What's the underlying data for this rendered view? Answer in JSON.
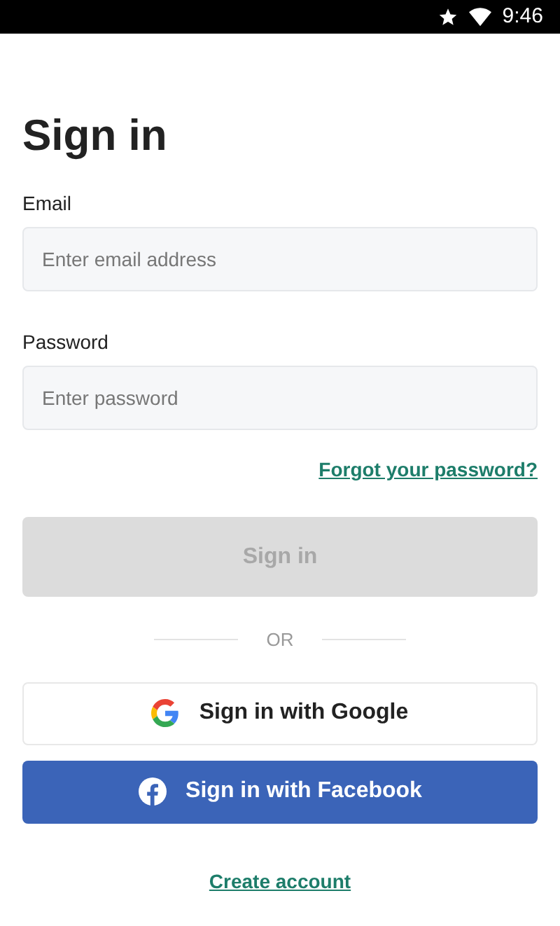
{
  "status_bar": {
    "time": "9:46"
  },
  "title": "Sign in",
  "fields": [
    {
      "label": "Email",
      "placeholder": "Enter email address"
    },
    {
      "label": "Password",
      "placeholder": "Enter password"
    }
  ],
  "forgot_link": "Forgot your password?",
  "sign_in_button": {
    "label": "Sign in",
    "disabled": true
  },
  "divider_text": "OR",
  "social_buttons": [
    {
      "kind": "google",
      "label": "Sign in with Google"
    },
    {
      "kind": "facebook",
      "label": "Sign in with Facebook"
    }
  ],
  "create_account_link": "Create account"
}
